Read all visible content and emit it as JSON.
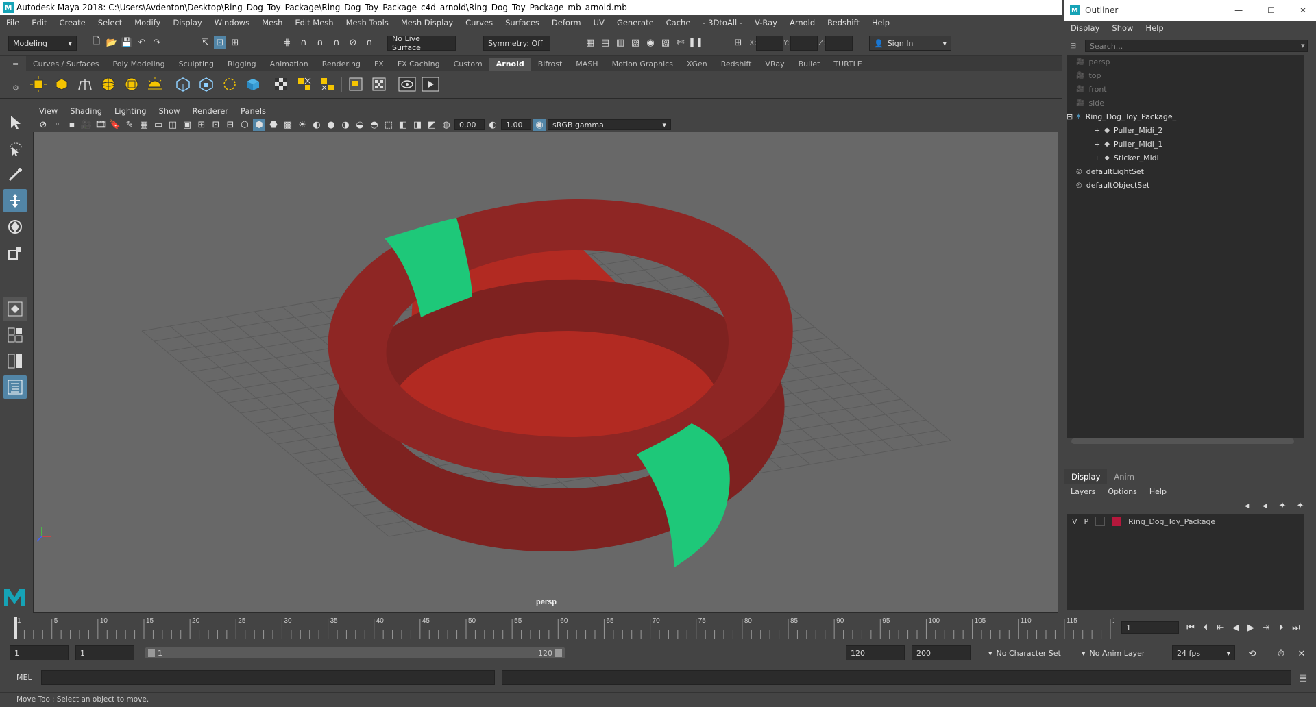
{
  "window": {
    "title": "Autodesk Maya 2018: C:\\Users\\Avdenton\\Desktop\\Ring_Dog_Toy_Package\\Ring_Dog_Toy_Package_c4d_arnold\\Ring_Dog_Toy_Package_mb_arnold.mb"
  },
  "menu": [
    "File",
    "Edit",
    "Create",
    "Select",
    "Modify",
    "Display",
    "Windows",
    "Mesh",
    "Edit Mesh",
    "Mesh Tools",
    "Mesh Display",
    "Curves",
    "Surfaces",
    "Deform",
    "UV",
    "Generate",
    "Cache",
    "- 3DtoAll -",
    "V-Ray",
    "Arnold",
    "Redshift",
    "Help"
  ],
  "status": {
    "mode": "Modeling",
    "live_surface": "No Live Surface",
    "symmetry": "Symmetry: Off",
    "x_label": "X:",
    "y_label": "Y:",
    "z_label": "Z:",
    "sign_in": "Sign In"
  },
  "shelf_tabs": [
    "Curves / Surfaces",
    "Poly Modeling",
    "Sculpting",
    "Rigging",
    "Animation",
    "Rendering",
    "FX",
    "FX Caching",
    "Custom",
    "Arnold",
    "Bifrost",
    "MASH",
    "Motion Graphics",
    "XGen",
    "Redshift",
    "VRay",
    "Bullet",
    "TURTLE"
  ],
  "shelf_active": "Arnold",
  "panel_menu": [
    "View",
    "Shading",
    "Lighting",
    "Show",
    "Renderer",
    "Panels"
  ],
  "panel_toolbar": {
    "exposure": "0.00",
    "gamma": "1.00",
    "colorspace": "sRGB gamma"
  },
  "viewport": {
    "camera_label": "persp"
  },
  "outliner": {
    "title": "Outliner",
    "menu": [
      "Display",
      "Show",
      "Help"
    ],
    "search_placeholder": "Search...",
    "items": [
      {
        "label": "persp",
        "indent": 1,
        "dim": true,
        "icon": "camera-icon"
      },
      {
        "label": "top",
        "indent": 1,
        "dim": true,
        "icon": "camera-icon"
      },
      {
        "label": "front",
        "indent": 1,
        "dim": true,
        "icon": "camera-icon"
      },
      {
        "label": "side",
        "indent": 1,
        "dim": true,
        "icon": "camera-icon"
      },
      {
        "label": "Ring_Dog_Toy_Package_",
        "indent": 1,
        "dim": false,
        "icon": "group-icon"
      },
      {
        "label": "Puller_Midi_2",
        "indent": 2,
        "dim": false,
        "icon": "mesh-icon"
      },
      {
        "label": "Puller_Midi_1",
        "indent": 2,
        "dim": false,
        "icon": "mesh-icon"
      },
      {
        "label": "Sticker_Midi",
        "indent": 2,
        "dim": false,
        "icon": "mesh-icon"
      },
      {
        "label": "defaultLightSet",
        "indent": 1,
        "dim": false,
        "icon": "set-icon"
      },
      {
        "label": "defaultObjectSet",
        "indent": 1,
        "dim": false,
        "icon": "set-icon"
      }
    ]
  },
  "layers": {
    "tabs": [
      "Display",
      "Anim"
    ],
    "menu": [
      "Layers",
      "Options",
      "Help"
    ],
    "row": {
      "v": "V",
      "p": "P",
      "name": "Ring_Dog_Toy_Package",
      "color": "#b5183c"
    }
  },
  "timeline": {
    "ticks": [
      "1",
      "5",
      "10",
      "15",
      "20",
      "25",
      "30",
      "35",
      "40",
      "45",
      "50",
      "55",
      "60",
      "65",
      "70",
      "75",
      "80",
      "85",
      "90",
      "95",
      "100",
      "105",
      "110",
      "115",
      "120"
    ],
    "current_frame": "1"
  },
  "range": {
    "start": "1",
    "inner_start": "1",
    "slider_start": "1",
    "slider_end": "120",
    "end": "120",
    "anim_end": "200",
    "character_set": "No Character Set",
    "anim_layer": "No Anim Layer",
    "fps": "24 fps"
  },
  "command": {
    "label": "MEL"
  },
  "help_line": "Move Tool: Select an object to move.",
  "colors": {
    "ring": "#8e2624",
    "sticker": "#1ec879",
    "card": "#b22a22",
    "active_tool": "#5285a6",
    "layer_swatch": "#b5183c"
  }
}
